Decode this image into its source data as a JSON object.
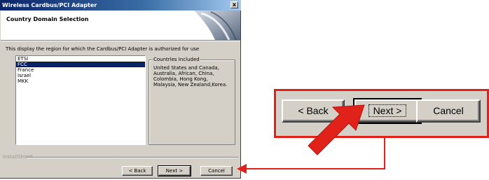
{
  "window": {
    "title": "Wireless Cardbus/PCI Adapter",
    "close_glyph": "x",
    "header_title": "Country Domain Selection"
  },
  "description": "This display the region for which the Cardbus/PCI Adapter is authorized for use",
  "domains": {
    "selected": "FCC",
    "items": [
      "ETSI",
      "FCC",
      "France",
      "Israel",
      "MKK"
    ]
  },
  "countries_group": {
    "label": "Countries Included",
    "text": "United States and Canada, Australia, African, China, Colombia, Hong Kong, Malaysia, New Zealand,Korea."
  },
  "footer": {
    "installshield_label": "InstallShield"
  },
  "buttons": {
    "back": "< Back",
    "next": "Next >",
    "cancel": "Cancel"
  },
  "zoom_panel": {
    "back": "< Back",
    "next": "Next >",
    "cancel": "Cancel"
  },
  "colors": {
    "highlight": "#e0221b",
    "title_bar": "#0a246a",
    "dialog_face": "#d4d0c8"
  }
}
